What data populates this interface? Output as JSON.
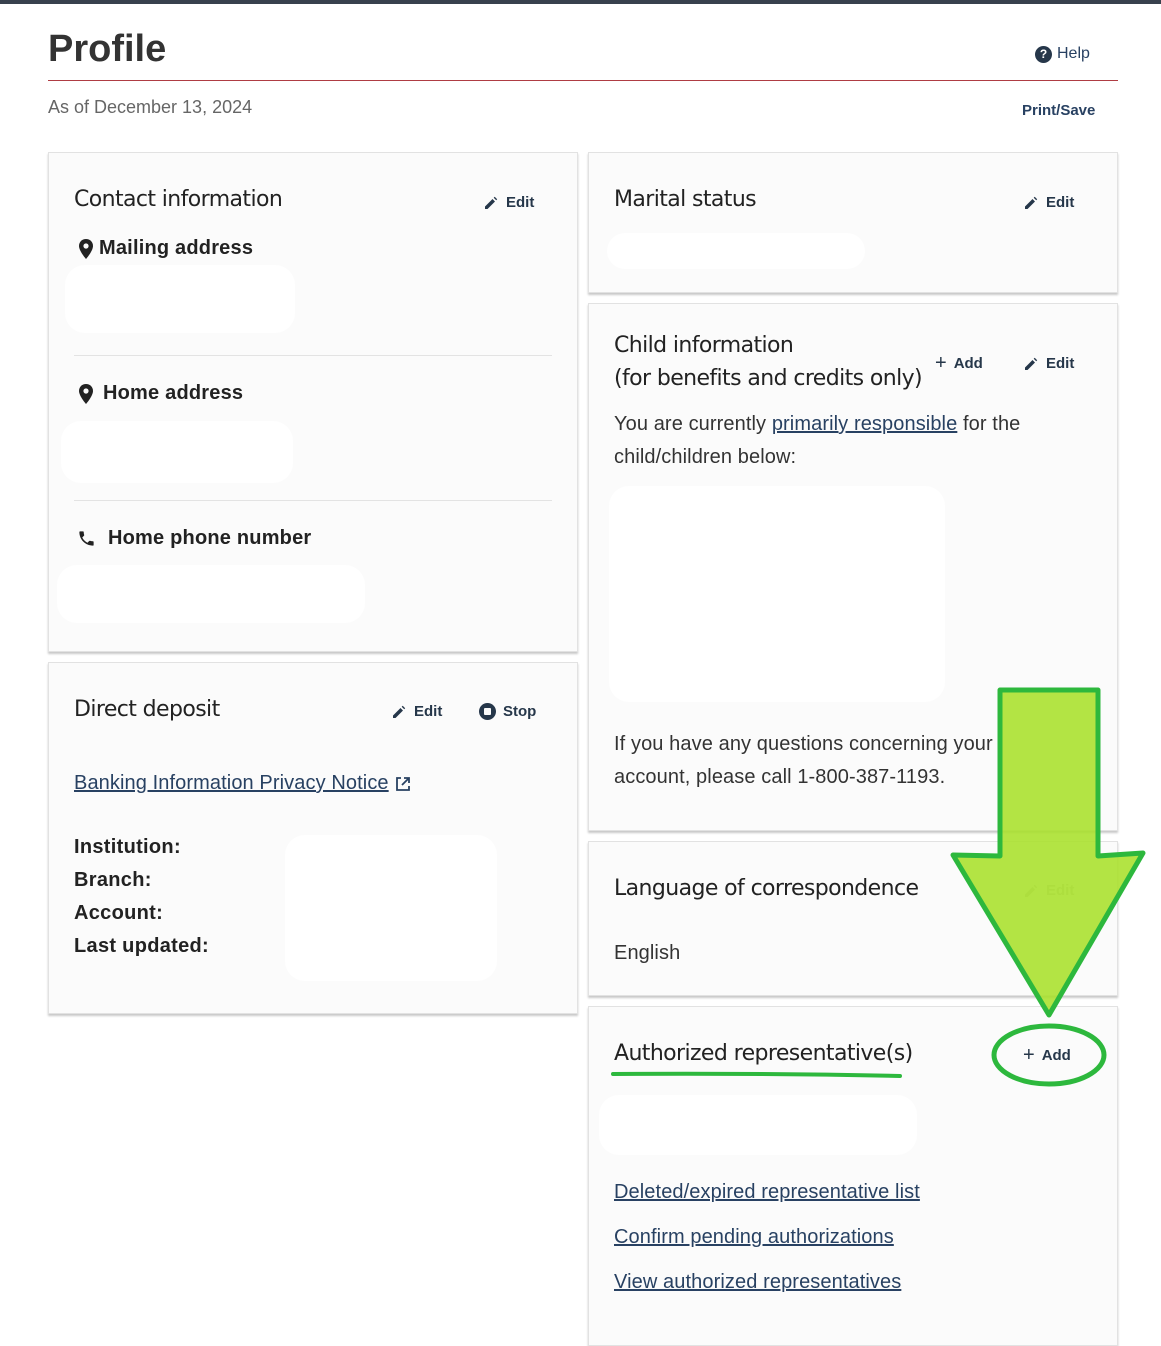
{
  "header": {
    "title": "Profile",
    "help_label": "Help",
    "help_icon": "question-circle-icon",
    "as_of": "As of December 13, 2024",
    "print_save_label": "Print/Save"
  },
  "contact": {
    "title": "Contact information",
    "edit_label": "Edit",
    "mailing_label": "Mailing address",
    "home_label": "Home address",
    "phone_label": "Home phone number"
  },
  "deposit": {
    "title": "Direct deposit",
    "edit_label": "Edit",
    "stop_label": "Stop",
    "privacy_link": "Banking Information Privacy Notice",
    "fields": {
      "institution": "Institution:",
      "branch": "Branch:",
      "account": "Account:",
      "last_updated": "Last updated:"
    }
  },
  "marital": {
    "title": "Marital status",
    "edit_label": "Edit"
  },
  "child": {
    "title_line1": "Child information",
    "title_line2": "(for benefits and credits only)",
    "add_label": "Add",
    "edit_label": "Edit",
    "intro_before": "You are currently ",
    "intro_link": "primarily responsible",
    "intro_after": " for the child/children below:",
    "questions_text": "If you have any questions concerning your account, please call 1-800-387-1193."
  },
  "language": {
    "title": "Language of correspondence",
    "edit_label": "Edit",
    "value": "English"
  },
  "representatives": {
    "title": "Authorized representative(s)",
    "add_label": "Add",
    "links": [
      "Deleted/expired representative list",
      "Confirm pending authorizations",
      "View authorized representatives"
    ]
  },
  "annotation": {
    "color": "#2db83d",
    "arrow_fill": "#a8e02a"
  }
}
